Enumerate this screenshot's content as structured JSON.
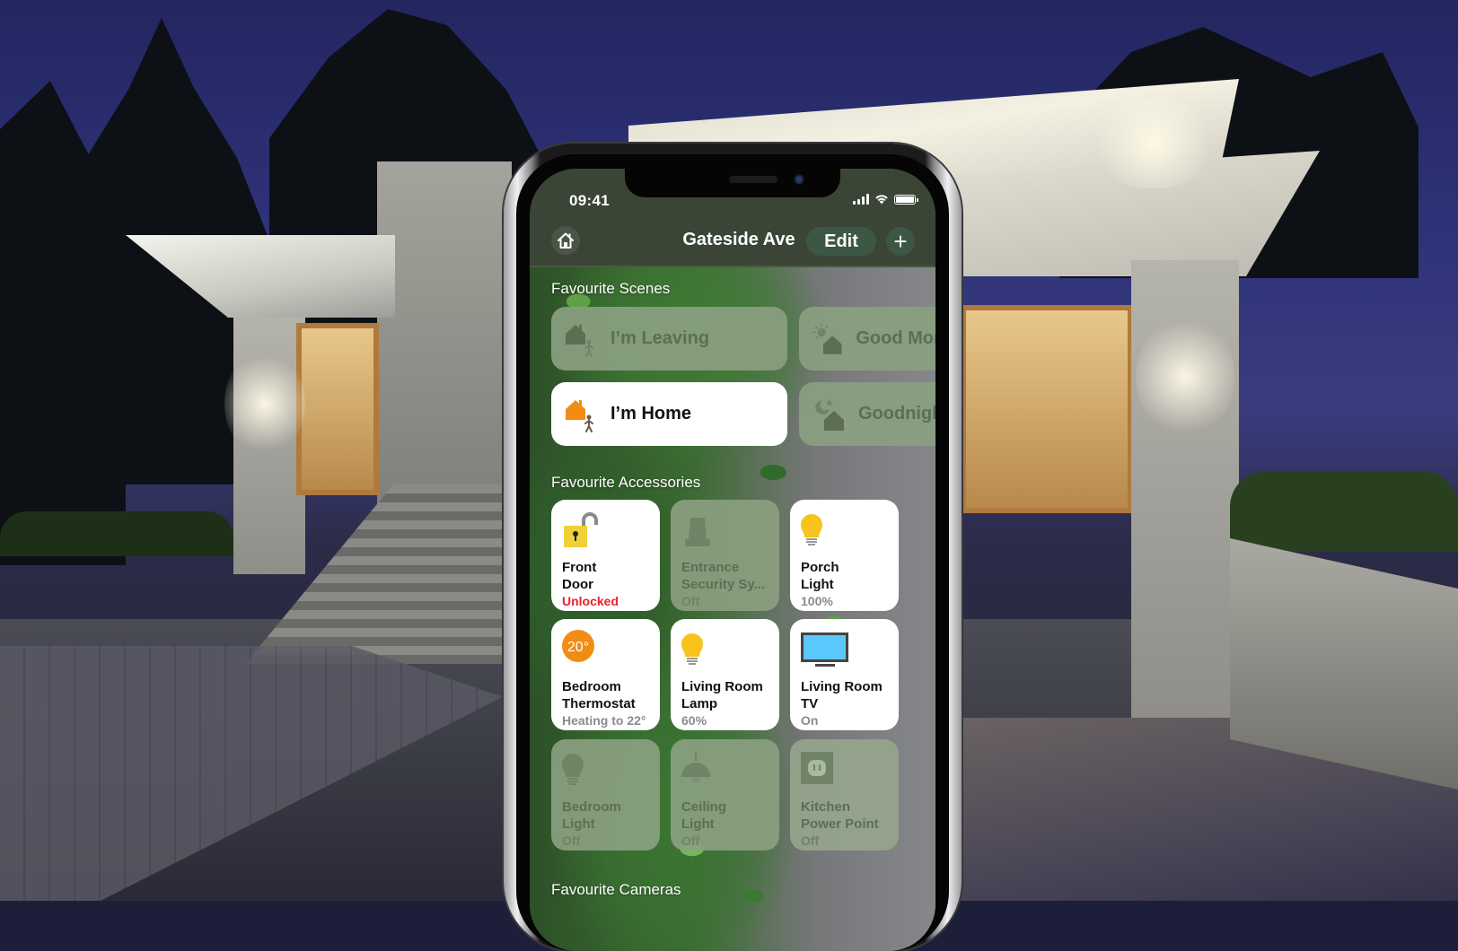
{
  "status_bar": {
    "time": "09:41",
    "icons": [
      "cellular-signal-icon",
      "wifi-icon",
      "battery-icon"
    ]
  },
  "header": {
    "home_icon": "house-icon",
    "title": "Gateside Ave",
    "edit_label": "Edit",
    "add_label": "+"
  },
  "sections": {
    "scenes": "Favourite Scenes",
    "accessories": "Favourite Accessories",
    "cameras": "Favourite Cameras"
  },
  "scenes": [
    {
      "label": "I’m Leaving",
      "icon": "leaving-home-icon",
      "state": "off"
    },
    {
      "label": "Good Morning",
      "icon": "good-morning-icon",
      "state": "off"
    },
    {
      "label": "I’m Home",
      "icon": "arrive-home-icon",
      "state": "on"
    },
    {
      "label": "Goodnight",
      "icon": "goodnight-icon",
      "state": "off"
    }
  ],
  "accessories": [
    {
      "name1": "Front",
      "name2": "Door",
      "status": "Unlocked",
      "icon": "unlocked-padlock-icon",
      "state": "on",
      "alert": true
    },
    {
      "name1": "Entrance",
      "name2": "Security Sy...",
      "status": "Off",
      "icon": "security-alarm-icon",
      "state": "off"
    },
    {
      "name1": "Porch",
      "name2": "Light",
      "status": "100%",
      "icon": "lightbulb-icon",
      "state": "on"
    },
    {
      "name1": "Bedroom",
      "name2": "Thermostat",
      "status": "Heating to 22°",
      "icon": "thermostat-icon",
      "icon_text": "20°",
      "state": "on"
    },
    {
      "name1": "Living Room",
      "name2": "Lamp",
      "status": "60%",
      "icon": "lightbulb-icon",
      "state": "on"
    },
    {
      "name1": "Living Room",
      "name2": "TV",
      "status": "On",
      "icon": "television-icon",
      "state": "on"
    },
    {
      "name1": "Bedroom",
      "name2": "Light",
      "status": "Off",
      "icon": "lightbulb-icon",
      "state": "off"
    },
    {
      "name1": "Ceiling",
      "name2": "Light",
      "status": "Off",
      "icon": "ceiling-lamp-icon",
      "state": "off"
    },
    {
      "name1": "Kitchen",
      "name2": "Power Point",
      "status": "Off",
      "icon": "power-outlet-icon",
      "state": "off"
    }
  ],
  "colors": {
    "alert_red": "#e8202a",
    "bulb_yellow": "#f7c31c",
    "thermostat_orange": "#f28c15",
    "home_orange": "#f28c15",
    "tv_blue": "#5ac8fa",
    "lock_yellow": "#f0d13a"
  }
}
